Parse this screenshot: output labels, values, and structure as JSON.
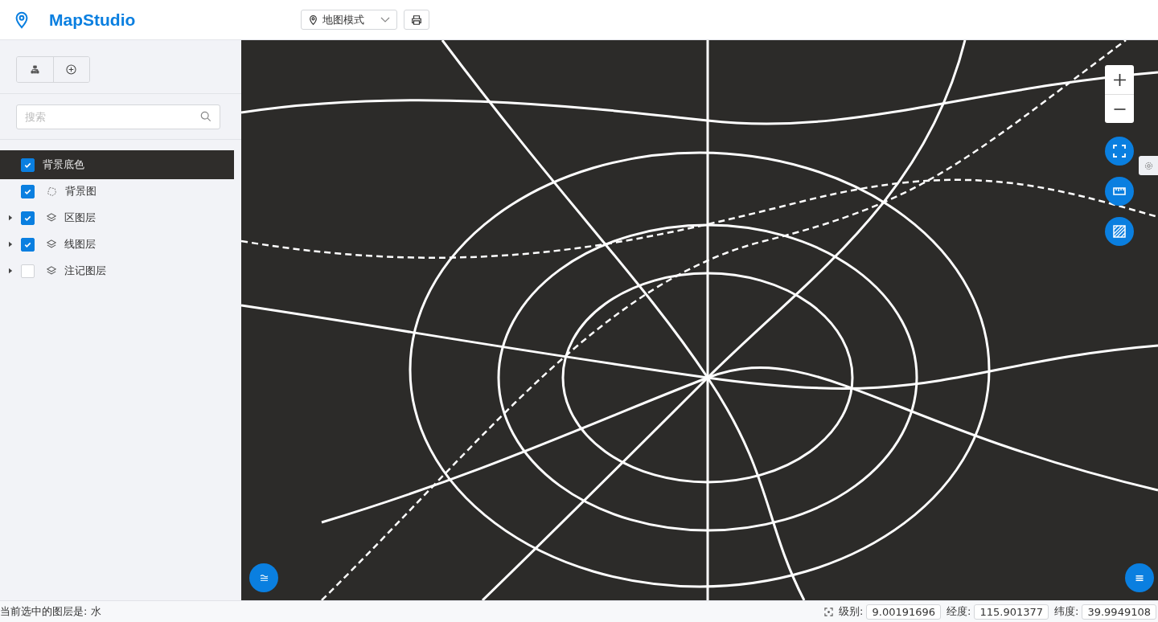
{
  "header": {
    "title": "MapStudio",
    "mode_select": {
      "value": "地图模式"
    }
  },
  "sidebar": {
    "search": {
      "placeholder": "搜索"
    },
    "layers": [
      {
        "label": "背景底色",
        "kind": "color",
        "checked": true,
        "selected": true,
        "expandable": false
      },
      {
        "label": "背景图",
        "kind": "image",
        "checked": true,
        "selected": false,
        "expandable": false
      },
      {
        "label": "区图层",
        "kind": "group",
        "checked": true,
        "selected": false,
        "expandable": true
      },
      {
        "label": "线图层",
        "kind": "group",
        "checked": true,
        "selected": false,
        "expandable": true
      },
      {
        "label": "注记图层",
        "kind": "group",
        "checked": false,
        "selected": false,
        "expandable": true
      }
    ]
  },
  "status_bar": {
    "message": "当前选中的图层是: 水",
    "level_label": "级别:",
    "level_value": "9.00191696",
    "lon_label": "经度:",
    "lon_value": "115.901377",
    "lat_label": "纬度:",
    "lat_value": "39.9949108"
  }
}
